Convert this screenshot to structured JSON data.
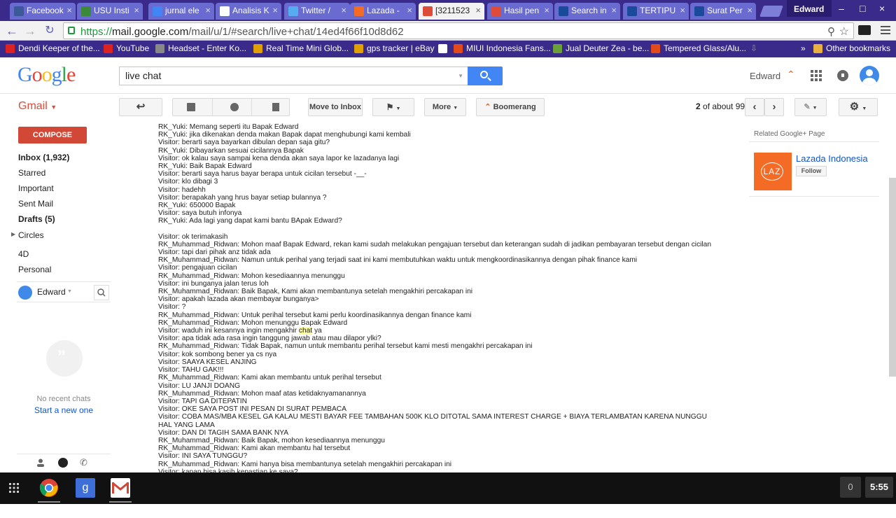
{
  "tabs": [
    {
      "label": "Facebook",
      "color": "#3b5998"
    },
    {
      "label": "USU Insti",
      "color": "#3a8a3a"
    },
    {
      "label": "jurnal ele",
      "color": "#4285f4"
    },
    {
      "label": "Analisis K",
      "color": "#ffffff"
    },
    {
      "label": "Twitter /",
      "color": "#55acee"
    },
    {
      "label": "Lazada -",
      "color": "#f36b24"
    },
    {
      "label": "[3211523",
      "color": "#dd4b39"
    },
    {
      "label": "Hasil pen",
      "color": "#dd4b39"
    },
    {
      "label": "Search in",
      "color": "#1a4a9a"
    },
    {
      "label": "TERTIPU",
      "color": "#1a4a9a"
    },
    {
      "label": "Surat Per",
      "color": "#1a4a9a"
    }
  ],
  "window_user": "Edward",
  "url": {
    "scheme": "https://",
    "domain": "mail.google.com",
    "path": "/mail/u/1/#search/live+chat/14ed4f66f10d8d62"
  },
  "bookmarks": [
    {
      "label": "Dendi Keeper of the...",
      "color": "#dd2222"
    },
    {
      "label": "YouTube",
      "color": "#dd2222"
    },
    {
      "label": "Headset - Enter Ko...",
      "color": "#888888"
    },
    {
      "label": "Real Time Mini Glob...",
      "color": "#e0a000"
    },
    {
      "label": "gps tracker | eBay",
      "color": "#e0a000"
    },
    {
      "label": "",
      "color": "#ffffff"
    },
    {
      "label": "MIUI Indonesia Fans...",
      "color": "#e34a1a"
    },
    {
      "label": "Jual Deuter Zea - be...",
      "color": "#6aa03a"
    },
    {
      "label": "Tempered Glass/Alu...",
      "color": "#e34a1a"
    }
  ],
  "bookmarks_overflow": "»",
  "other_bookmarks": "Other bookmarks",
  "header": {
    "search_value": "live chat",
    "user_name": "Edward"
  },
  "toolbar": {
    "gmail_label": "Gmail",
    "move_to_inbox": "Move to Inbox",
    "more": "More",
    "boomerang": "Boomerang",
    "pager_bold": "2",
    "pager_rest": " of about 99"
  },
  "sidebar": {
    "compose": "COMPOSE",
    "inbox": "Inbox (1,932)",
    "starred": "Starred",
    "important": "Important",
    "sent": "Sent Mail",
    "drafts": "Drafts (5)",
    "circles": "Circles",
    "l4d": "4D",
    "personal": "Personal",
    "chat_user": "Edward",
    "no_chats": "No recent chats",
    "start_new": "Start a new one"
  },
  "chat_lines": [
    "RK_Yuki: Memang seperti itu Bapak Edward",
    "RK_Yuki: jika dikenakan denda makan Bapak dapat menghubungi kami kembali",
    "Visitor: berarti saya bayarkan dibulan depan saja gitu?",
    "RK_Yuki: Dibayarkan sesuai cicilannya Bapak",
    "Visitor: ok kalau saya sampai kena denda akan saya lapor ke lazadanya lagi",
    "RK_Yuki: Baik Bapak Edward",
    "Visitor: berarti saya harus bayar berapa untuk cicilan tersebut -__-",
    "Visitor: klo dibagi 3",
    "Visitor: hadehh",
    "Visitor: berapakah yang hrus bayar setiap bulannya ?",
    "RK_Yuki: 650000 Bapak",
    "Visitor: saya butuh infonya",
    "RK_Yuki: Ada lagi yang dapat kami bantu BApak Edward?",
    "",
    "Visitor: ok terimakasih",
    "RK_Muhammad_Ridwan: Mohon maaf Bapak Edward, rekan kami sudah melakukan pengajuan tersebut dan keterangan sudah di jadikan pembayaran tersebut dengan cicilan",
    "Visitor: tapi dari pihak anz tidak ada",
    "RK_Muhammad_Ridwan: Namun untuk perihal yang terjadi saat ini kami membutuhkan waktu untuk mengkoordinasikannya dengan pihak finance kami",
    "Visitor: pengajuan cicilan",
    "RK_Muhammad_Ridwan: Mohon kesediaannya menunggu",
    "Visitor: ini bunganya jalan terus loh",
    "RK_Muhammad_Ridwan: Baik Bapak, Kami akan membantunya setelah mengakhiri percakapan ini",
    "Visitor: apakah lazada akan membayar bunganya>",
    "Visitor: ?",
    "RK_Muhammad_Ridwan: Untuk perihal tersebut kami perlu koordinasikannya dengan finance kami",
    "RK_Muhammad_Ridwan: Mohon menunggu Bapak Edward",
    "Visitor: waduh ini kesannya ingin mengakhir chat ya",
    "Visitor: apa tidak ada rasa ingin tanggung jawab atau mau dilapor ylki?",
    "RK_Muhammad_Ridwan: Tidak Bapak, namun untuk membantu perihal tersebut kami mesti mengakhri percakapan ini",
    "Visitor: kok sombong bener ya cs nya",
    "Visitor: SAAYA KESEL ANJING",
    "Visitor: TAHU GAK!!!",
    "RK_Muhammad_Ridwan: Kami akan membantu untuk perihal tersebut",
    "Visitor: LU JANJI DOANG",
    "RK_Muhammad_Ridwan: Mohon maaf atas ketidaknyamanannya",
    "Visitor: TAPI GA DITEPATIN",
    "Visitor: OKE SAYA POST INI PESAN DI SURAT PEMBACA",
    "Visitor: COBA MAS/MBA KESEL GA KALAU MESTI BAYAR FEE TAMBAHAN 500K KLO DITOTAL SAMA INTEREST CHARGE + BIAYA TERLAMBATAN KARENA NUNGGU",
    "HAL YANG LAMA",
    "Visitor: DAN DI TAGIH SAMA BANK NYA",
    "RK_Muhammad_Ridwan: Baik Bapak, mohon kesediaannya menunggu",
    "RK_Muhammad_Ridwan: Kami akan membantu hal tersebut",
    "Visitor: INI SAYA TUNGGU?",
    "RK_Muhammad_Ridwan: Kami hanya bisa membantunya setelah mengakhiri percakapan ini",
    "Visitor: kapan bisa kasih kepastian ke saya?"
  ],
  "highlight_line": {
    "before": "Visitor: waduh ini kesannya ingin mengakhir ",
    "hl": "chat",
    "after": " ya"
  },
  "right_panel": {
    "title": "Related Google+ Page",
    "page_name": "Lazada Indonesia",
    "logo_text": "LAZ",
    "follow": "Follow"
  },
  "taskbar": {
    "badge": "0",
    "clock": "5:55"
  }
}
